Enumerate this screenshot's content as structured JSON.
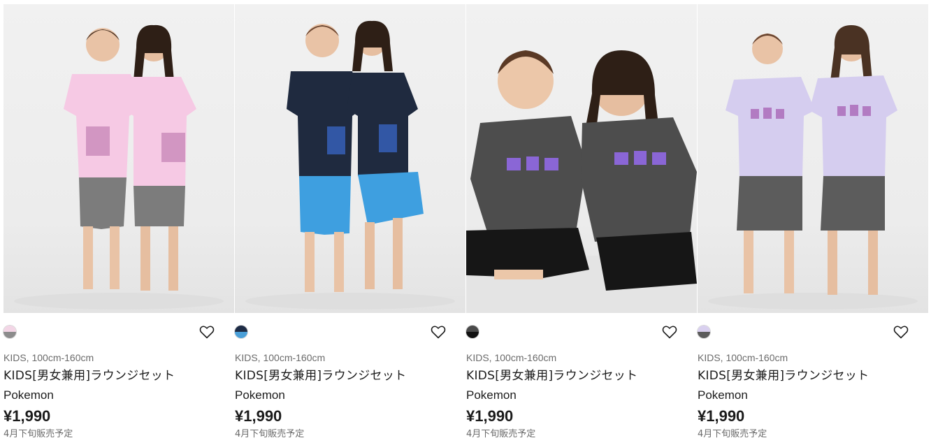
{
  "products": [
    {
      "category": "KIDS, 100cm-160cm",
      "title": "KIDS[男女兼用]ラウンジセット",
      "subtitle": "Pokemon",
      "price": "¥1,990",
      "release": "4月下旬販売予定",
      "swatch": {
        "top": "#f3d6e6",
        "bottom": "#8c8c8c"
      },
      "photo": {
        "shirt": "#f6c9e4",
        "shirt_trim": "#f9dcec",
        "shorts": "#7c7c7c",
        "print": "sylveon-pixel-art",
        "setting": "standing"
      }
    },
    {
      "category": "KIDS, 100cm-160cm",
      "title": "KIDS[男女兼用]ラウンジセット",
      "subtitle": "Pokemon",
      "price": "¥1,990",
      "release": "4月下旬販売予定",
      "swatch": {
        "top": "#1d2b45",
        "bottom": "#4a9fd8"
      },
      "photo": {
        "shirt": "#1f2a3f",
        "shirt_trim": "#c9d2e0",
        "shorts": "#3e9fe0",
        "print": "lucario-pixel-art",
        "setting": "standing"
      }
    },
    {
      "category": "KIDS, 100cm-160cm",
      "title": "KIDS[男女兼用]ラウンジセット",
      "subtitle": "Pokemon",
      "price": "¥1,990",
      "release": "4月下旬販売予定",
      "swatch": {
        "top": "#4a4a4a",
        "bottom": "#111111"
      },
      "photo": {
        "shirt": "#4d4d4d",
        "shirt_trim": "#cfcfcf",
        "shorts": "#161616",
        "print": "gengar-pixel-art",
        "setting": "sitting"
      }
    },
    {
      "category": "KIDS, 100cm-160cm",
      "title": "KIDS[男女兼用]ラウンジセット",
      "subtitle": "Pokemon",
      "price": "¥1,990",
      "release": "4月下旬販売予定",
      "swatch": {
        "top": "#d9d0ef",
        "bottom": "#5c5c5c"
      },
      "photo": {
        "shirt": "#d5cdef",
        "shirt_trim": "#ece7f8",
        "shorts": "#5c5c5c",
        "print": "mew-pixel-art",
        "setting": "standing"
      }
    }
  ],
  "icons": {
    "favorite": "heart-outline-icon"
  }
}
